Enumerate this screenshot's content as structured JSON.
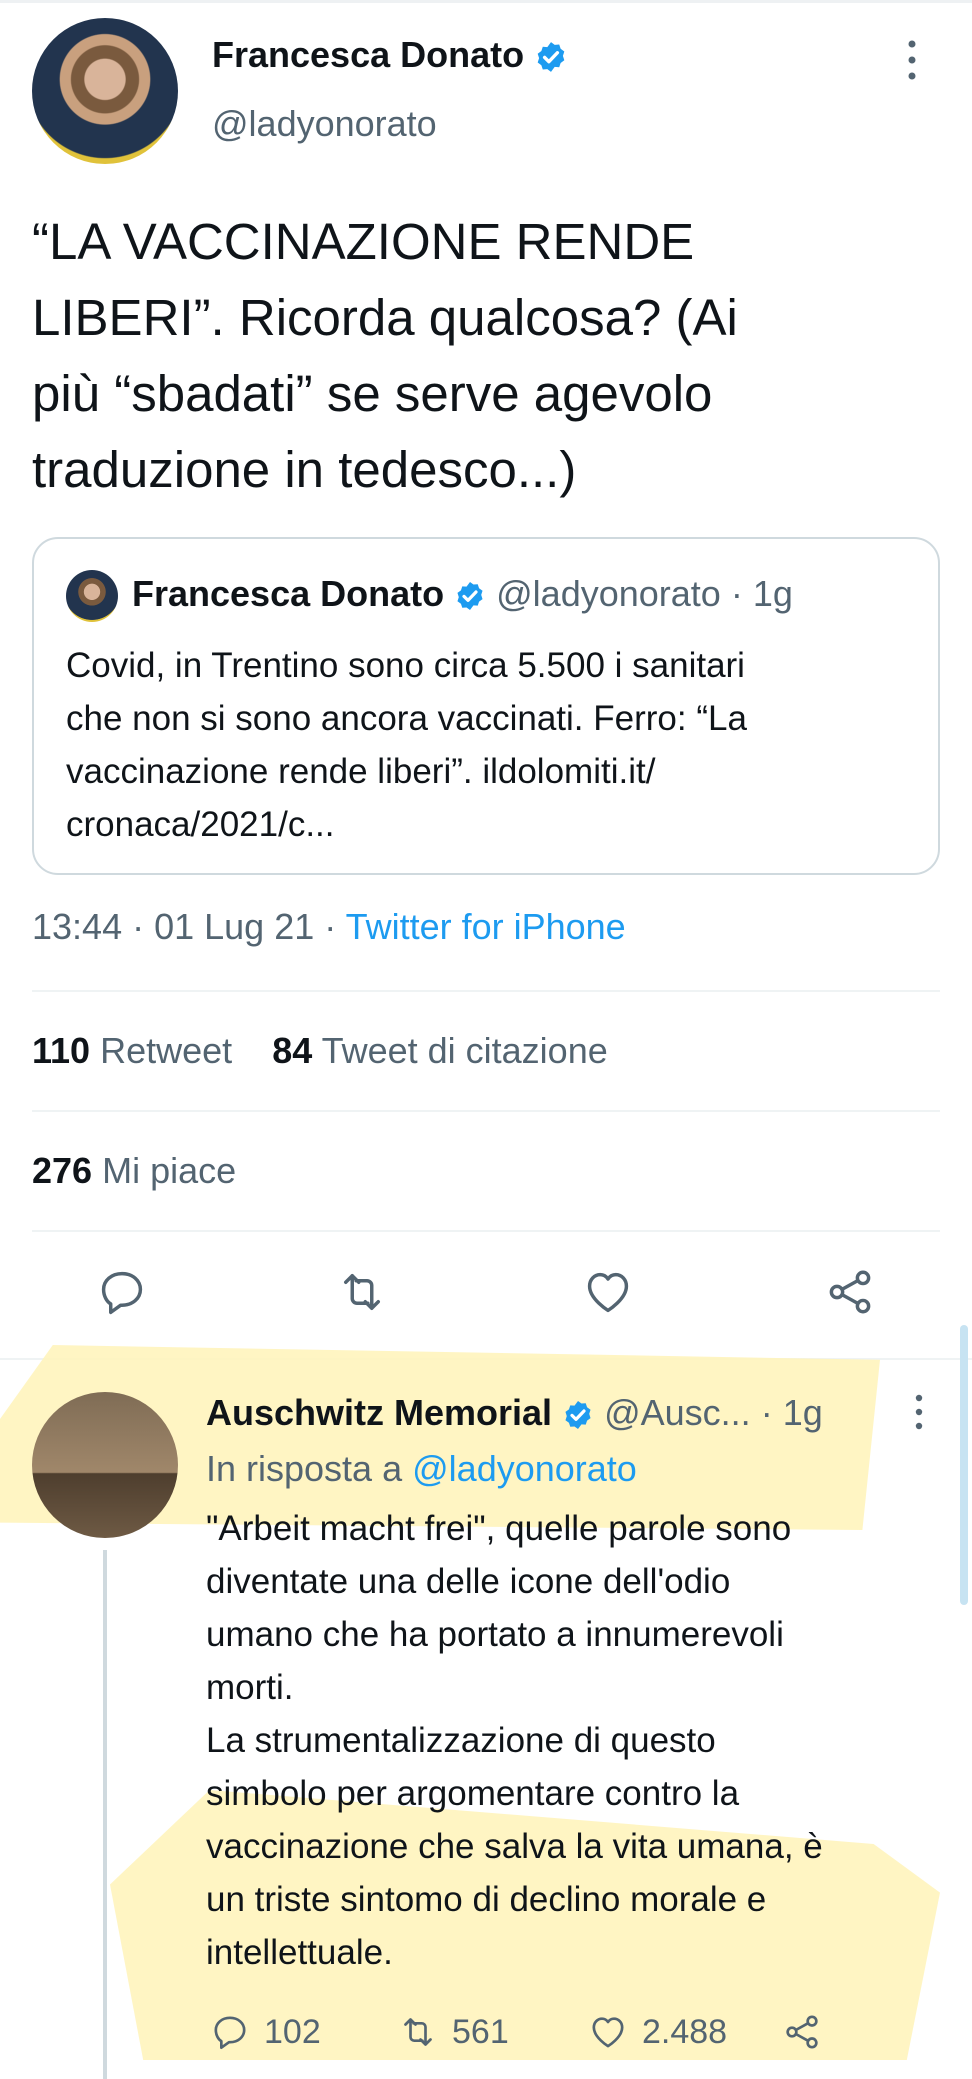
{
  "tweet": {
    "author_name": "Francesca Donato",
    "author_handle": "@ladyonorato",
    "text": "“LA VACCINAZIONE RENDE\nLIBERI”. Ricorda qualcosa? (Ai\npiù “sbadati” se serve agevolo\ntraduzione in tedesco...)",
    "timestamp": "13:44 · 01 Lug 21 · ",
    "source": "Twitter for iPhone",
    "retweets_count": "110",
    "retweets_label": "Retweet",
    "quotes_count": "84",
    "quotes_label": "Tweet di citazione",
    "likes_count": "276",
    "likes_label": "Mi piace"
  },
  "quoted_tweet": {
    "author_name": "Francesca Donato",
    "author_handle": "@ladyonorato",
    "time": "· 1g",
    "text": "Covid, in Trentino sono circa 5.500 i sanitari\nche non si sono ancora vaccinati. Ferro: “La\nvaccinazione rende liberi”.  ildolomiti.it/\ncronaca/2021/c..."
  },
  "reply": {
    "author_name": "Auschwitz Memorial",
    "author_handle": "@Ausc...",
    "time": "· 1g",
    "reply_to_label": "In risposta a",
    "reply_to_handle": "@ladyonorato",
    "text": "\"Arbeit macht frei\", quelle parole sono\ndiventate una delle icone dell'odio\numano che ha portato a innumerevoli\nmorti.\n La strumentalizzazione di questo\nsimbolo per argomentare contro la\nvaccinazione che salva la vita umana, è\nun triste sintomo di declino morale e\nintellettuale.",
    "reply_count": "102",
    "retweet_count": "561",
    "like_count": "2.488"
  },
  "icons": [
    "verified-badge-icon",
    "more-icon",
    "reply-icon",
    "retweet-icon",
    "like-icon",
    "share-icon"
  ],
  "colors": {
    "accent": "#1d9bf0",
    "text": "#0f1419",
    "secondary": "#536471",
    "highlight": "#fff3b8"
  }
}
